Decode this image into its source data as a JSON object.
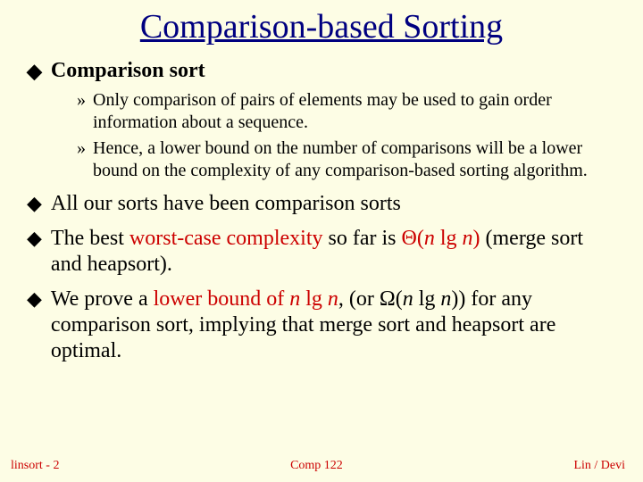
{
  "title": "Comparison-based Sorting",
  "section": "Comparison sort",
  "sub1": "Only comparison of pairs of elements may be used to gain order information about a sequence.",
  "sub2": "Hence, a lower bound on the number of comparisons will be a lower bound on the complexity of any comparison-based sorting algorithm.",
  "b1": "All our sorts have been comparison sorts",
  "b2a": "The best ",
  "b2b": "worst-case complexity",
  "b2c": " so far is ",
  "b2d": "Θ(",
  "b2e": "n",
  "b2f": " lg ",
  "b2g": "n",
  "b2h": ")",
  "b2i": " (merge sort and heapsort).",
  "b3a": "We prove a ",
  "b3b": "lower bound of ",
  "b3c": "n",
  "b3d": " lg ",
  "b3e": "n",
  "b3f": ", (or Ω(",
  "b3g": "n",
  "b3h": " lg ",
  "b3i": "n",
  "b3j": ")) for any comparison sort, implying that merge sort and heapsort are optimal.",
  "footer_left": "linsort - 2",
  "footer_mid": "Comp 122",
  "footer_right": "Lin / Devi"
}
